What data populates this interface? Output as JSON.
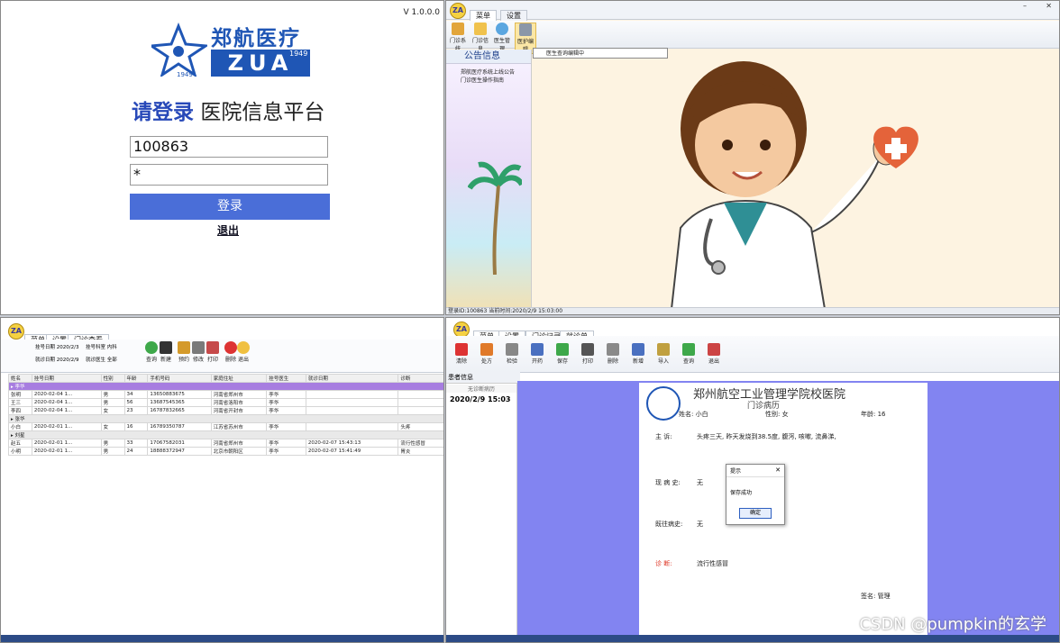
{
  "login": {
    "version": "V 1.0.0.0",
    "logo_cn": "郑航医疗",
    "logo_en": "ZUA",
    "logo_year": "1949",
    "title_highlight": "请登录",
    "title_rest": "医院信息平台",
    "username": "100863",
    "password": "*",
    "login_button": "登录",
    "exit_link": "退出"
  },
  "main": {
    "tabs": [
      "菜单",
      "设置"
    ],
    "ribbon": [
      "门诊系统",
      "门诊信息",
      "医生管理",
      "医护编辑"
    ],
    "dropdown_item": "医生查询编辑中",
    "side_title": "公告信息",
    "side_items": [
      "郑航医疗系统上线公告",
      "门诊医生操作指南"
    ],
    "status": "登录ID:100863  当前时间:2020/2/9 15:03:00"
  },
  "list": {
    "tabs": [
      "菜单",
      "设置",
      "门诊查看"
    ],
    "filters": [
      "挂号日期 2020/2/3",
      "就诊日期 2020/2/9",
      "挂号科室 内科",
      "就诊医生 全部"
    ],
    "ribbon": [
      "查询",
      "新建",
      "预约",
      "修改",
      "打印",
      "删除",
      "退出"
    ],
    "headers": [
      "姓名",
      "挂号日期",
      "性别",
      "年龄",
      "手机号码",
      "家庭住址",
      "挂号医生",
      "就诊日期",
      "诊断"
    ],
    "group1": "▸ 李华",
    "rows1": [
      [
        "张明",
        "2020-02-04 1...",
        "男",
        "34",
        "13650883675",
        "河南省郑州市",
        "李华",
        "",
        ""
      ],
      [
        "王三",
        "2020-02-04 1...",
        "男",
        "56",
        "13687545365",
        "河南省洛阳市",
        "李华",
        "",
        ""
      ],
      [
        "李四",
        "2020-02-04 1...",
        "女",
        "23",
        "16787832665",
        "河南省开封市",
        "李华",
        "",
        ""
      ]
    ],
    "group2": "▸ 张华",
    "rows2": [
      [
        "小白",
        "2020-02-01 1...",
        "女",
        "16",
        "16789350787",
        "江苏省苏州市",
        "李华",
        "",
        "头疼"
      ]
    ],
    "group3": "▸ 刘星",
    "rows3": [
      [
        "赵五",
        "2020-02-01 1...",
        "男",
        "33",
        "17067582031",
        "河南省郑州市",
        "李华",
        "2020-02-07 15:43:13",
        "流行性感冒"
      ],
      [
        "小明",
        "2020-02-01 1...",
        "男",
        "24",
        "18888372947",
        "北京市朝阳区",
        "李华",
        "2020-02-07 15:41:49",
        "胃炎"
      ]
    ]
  },
  "record": {
    "tabs": [
      "菜单",
      "设置",
      "门诊记录",
      "就诊单"
    ],
    "ribbon": [
      "清除",
      "处方",
      "检验",
      "开药",
      "保存",
      "打印",
      "删除",
      "新增",
      "导入",
      "查询",
      "退出"
    ],
    "left_header": "患者信息",
    "left_date": "2020/2/9 15:03",
    "hospital": "郑州航空工业管理学院校医院",
    "sheet": "门诊病历",
    "name": "姓名: 小白",
    "gender": "性别: 女",
    "age": "年龄: 16",
    "complaint_label": "主   诉:",
    "complaint": "头疼三天, 昨天发烧到38.5度, 腹泻, 咳嗽, 流鼻涕,",
    "present_label": "现 病 史:",
    "present": "无",
    "past_label": "既往病史:",
    "past": "无",
    "diag_label": "诊   断:",
    "diag": "流行性感冒",
    "signature": "签名: 管理",
    "dialog_title": "提示",
    "dialog_msg": "保存成功",
    "dialog_btn": "确定",
    "watermark": "CSDN @pumpkin的玄学"
  }
}
